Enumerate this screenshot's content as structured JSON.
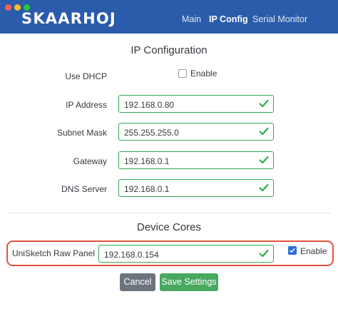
{
  "header": {
    "brand": "SKAARHOJ",
    "nav": [
      {
        "label": "Main",
        "active": false
      },
      {
        "label": "IP Config",
        "active": true
      },
      {
        "label": "Serial Monitor",
        "active": false
      }
    ]
  },
  "ip_config": {
    "title": "IP Configuration",
    "dhcp": {
      "label": "Use DHCP",
      "checkbox_label": "Enable",
      "checked": false
    },
    "fields": [
      {
        "label": "IP Address",
        "value": "192.168.0.80"
      },
      {
        "label": "Subnet Mask",
        "value": "255.255.255.0"
      },
      {
        "label": "Gateway",
        "value": "192.168.0.1"
      },
      {
        "label": "DNS Server",
        "value": "192.168.0.1"
      }
    ]
  },
  "device_cores": {
    "title": "Device Cores",
    "core": {
      "label": "UniSketch Raw Panel",
      "value": "192.168.0.154",
      "checkbox_label": "Enable",
      "checked": true
    }
  },
  "actions": {
    "cancel_label": "Cancel",
    "save_label": "Save Settings"
  },
  "colors": {
    "navbar": "#2a5cab",
    "valid_border": "#2eaa4f",
    "highlight": "#e0533d",
    "save_button": "#48a860",
    "cancel_button": "#6c757d"
  }
}
